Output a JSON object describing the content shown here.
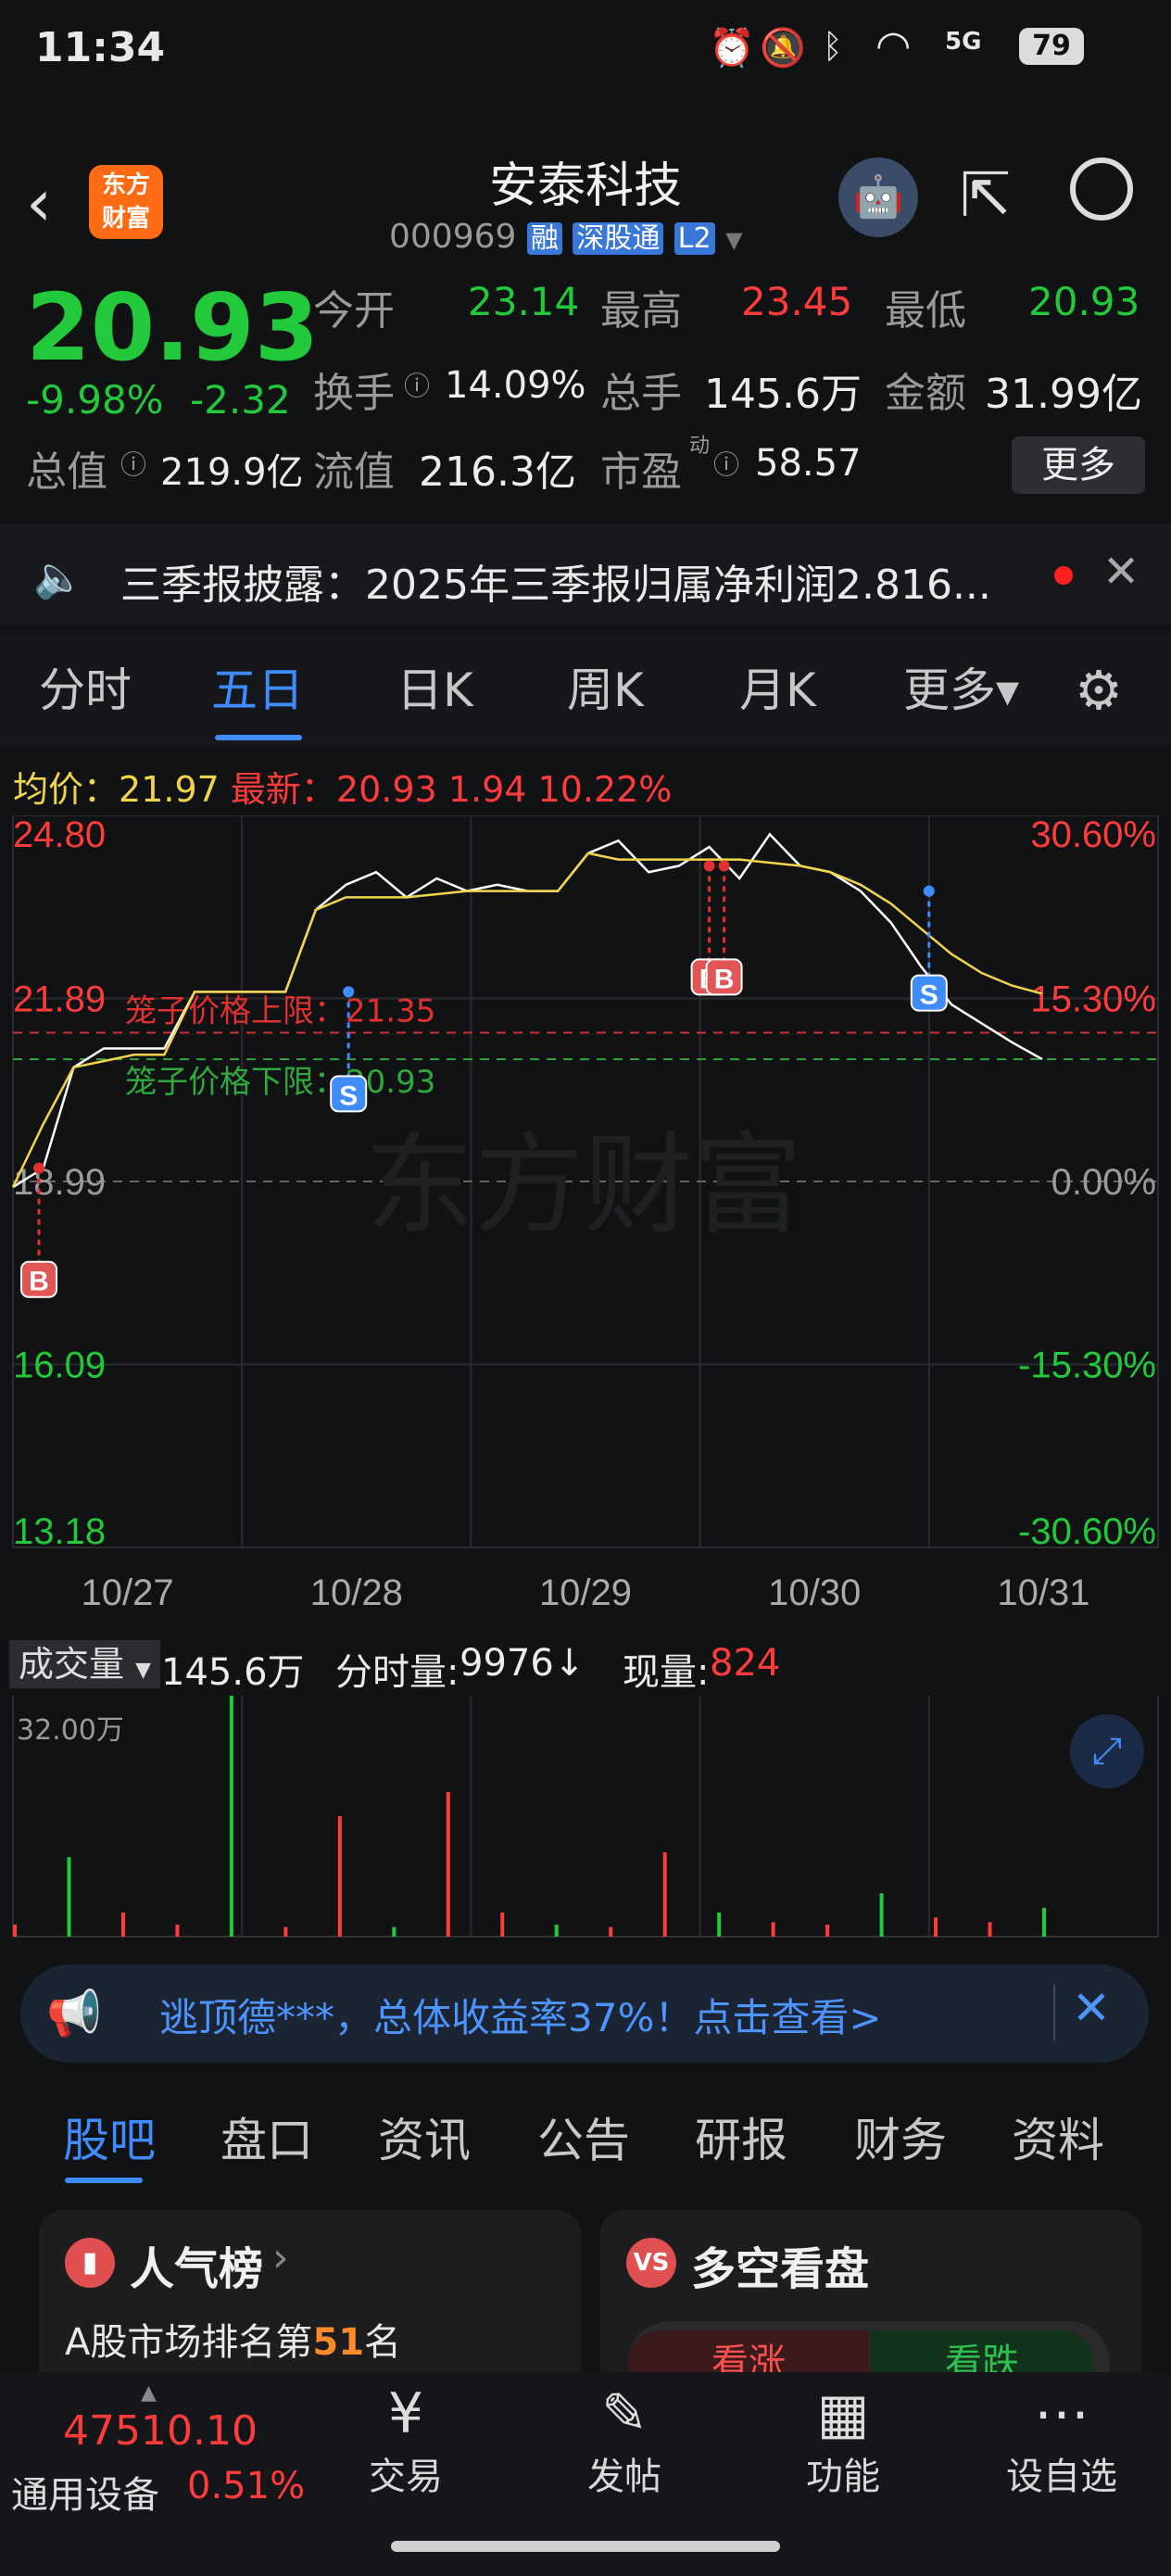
{
  "status_bar": {
    "time": "11:34",
    "battery": "79",
    "network": "5G"
  },
  "header": {
    "app_badge": "东方\n财富",
    "stock_name": "安泰科技",
    "stock_code": "000969",
    "tags": [
      "融",
      "深股通",
      "L2"
    ]
  },
  "quote": {
    "price": "20.93",
    "change_pct": "-9.98%",
    "change": "-2.32",
    "open_label": "今开",
    "open": "23.14",
    "high_label": "最高",
    "high": "23.45",
    "low_label": "最低",
    "low": "20.93",
    "turnover_label": "换手",
    "turnover": "14.09%",
    "volume_label": "总手",
    "volume": "145.6万",
    "amount_label": "金额",
    "amount": "31.99亿",
    "mktcap_label": "总值",
    "mktcap": "219.9亿",
    "float_label": "流值",
    "float": "216.3亿",
    "pe_label": "市盈",
    "pe_sup": "动",
    "pe": "58.57",
    "more_label": "更多"
  },
  "news": {
    "text": "三季报披露：2025年三季报归属净利润2.816..."
  },
  "tabs": [
    {
      "label": "分时"
    },
    {
      "label": "五日",
      "active": true
    },
    {
      "label": "日K"
    },
    {
      "label": "周K"
    },
    {
      "label": "月K"
    },
    {
      "label": "更多▾"
    }
  ],
  "chart_info": {
    "avg_label": "均价：",
    "avg": "21.97",
    "latest_label": "最新：",
    "latest": "20.93",
    "latest_change": "1.94",
    "latest_pct": "10.22%"
  },
  "chart_data": {
    "type": "line",
    "y_left_ticks": [
      "24.80",
      "21.89",
      "18.99",
      "16.09",
      "13.18"
    ],
    "y_right_ticks": [
      "30.60%",
      "15.30%",
      "0.00%",
      "-15.30%",
      "-30.60%"
    ],
    "x_ticks": [
      "10/27",
      "10/28",
      "10/29",
      "10/30",
      "10/31"
    ],
    "ylim": [
      13.18,
      24.8
    ],
    "upper_limit_label": "笼子价格上限：21.35",
    "upper_limit": 21.35,
    "lower_limit_label": "笼子价格下限：20.93",
    "lower_limit": 20.93,
    "watermark": "东方财富",
    "series": [
      {
        "name": "price",
        "color": "#ffffff",
        "values": [
          18.9,
          19.2,
          20.8,
          21.1,
          21.1,
          21.1,
          22.0,
          22.0,
          22.0,
          22.0,
          23.3,
          23.7,
          23.9,
          23.5,
          23.8,
          23.6,
          23.7,
          23.6,
          23.6,
          24.2,
          24.4,
          23.9,
          24.0,
          24.3,
          23.8,
          24.5,
          24.0,
          23.9,
          23.6,
          23.1,
          22.4,
          21.8,
          21.5,
          21.2,
          20.93
        ]
      },
      {
        "name": "avg",
        "color": "#f2d44c",
        "values": [
          18.9,
          19.9,
          20.8,
          20.9,
          21.0,
          21.0,
          22.0,
          22.0,
          22.0,
          22.0,
          23.3,
          23.5,
          23.5,
          23.5,
          23.55,
          23.6,
          23.6,
          23.6,
          23.6,
          24.2,
          24.1,
          24.1,
          24.1,
          24.1,
          24.1,
          24.05,
          24.0,
          23.9,
          23.7,
          23.4,
          23.0,
          22.6,
          22.3,
          22.1,
          21.97
        ]
      }
    ],
    "markers": [
      {
        "label": "B",
        "day": 0
      },
      {
        "label": "S",
        "day": 1
      },
      {
        "label": "B",
        "day": 3
      },
      {
        "label": "B",
        "day": 3
      },
      {
        "label": "S",
        "day": 4
      }
    ]
  },
  "volume": {
    "selector": "成交量",
    "total": "145.6万",
    "tick_label": "分时量:",
    "tick_value": "9976↓",
    "now_label": "现量:",
    "now_value": "824",
    "scale": "32.00万",
    "bars": [
      0.05,
      0.33,
      0.1,
      0.05,
      1.0,
      0.04,
      0.5,
      0.04,
      0.6,
      0.1,
      0.05,
      0.04,
      0.35,
      0.1,
      0.06,
      0.05,
      0.18,
      0.08,
      0.06,
      0.12
    ]
  },
  "ad": {
    "text": "逃顶德***，总体收益率37%！点击查看>"
  },
  "subtabs": [
    {
      "label": "股吧",
      "active": true
    },
    {
      "label": "盘口"
    },
    {
      "label": "资讯"
    },
    {
      "label": "公告"
    },
    {
      "label": "研报"
    },
    {
      "label": "财务"
    },
    {
      "label": "资料"
    }
  ],
  "cards": {
    "left_title": "人气榜",
    "left_desc_prefix": "A股市场排名第",
    "left_rank": "51",
    "left_desc_suffix": "名",
    "right_title": "多空看盘",
    "up_label": "看涨",
    "down_label": "看跌"
  },
  "bottom_bar": {
    "index_value": "47510.10",
    "index_name": "通用设备",
    "index_change": "0.51%",
    "items": [
      {
        "label": "交易"
      },
      {
        "label": "发帖"
      },
      {
        "label": "功能"
      },
      {
        "label": "设自选"
      }
    ]
  },
  "colors": {
    "up": "#ff3b3b",
    "down": "#22c93a",
    "accent": "#3f8cff"
  }
}
